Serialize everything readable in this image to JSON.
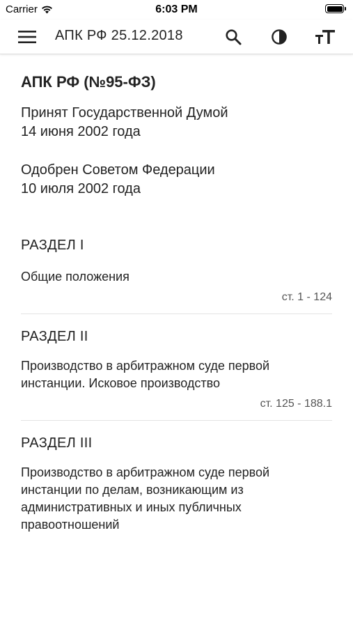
{
  "status_bar": {
    "carrier": "Carrier",
    "time": "6:03 PM",
    "battery_level": 1.0
  },
  "app_bar": {
    "title": "АПК РФ 25.12.2018",
    "actions": [
      "search-icon",
      "contrast-icon",
      "text-size-icon"
    ]
  },
  "document": {
    "title": "АПК РФ (№95-ФЗ)",
    "adopted_line1": "Принят Государственной Думой",
    "adopted_line2": "14 июня 2002 года",
    "approved_line1": "Одобрен Советом Федерации",
    "approved_line2": "10 июля 2002 года"
  },
  "sections": [
    {
      "heading": "РАЗДЕЛ I",
      "description": "Общие положения",
      "range": "ст. 1 - 124"
    },
    {
      "heading": "РАЗДЕЛ II",
      "description_line1": "Производство в арбитражном суде первой",
      "description_line2": "инстанции. Исковое производство",
      "range": "ст. 125 - 188.1"
    },
    {
      "heading": "РАЗДЕЛ III",
      "description_line1": "Производство в арбитражном суде первой",
      "description_line2": "инстанции по делам, возникающим из",
      "description_line3": "административных и иных публичных",
      "description_line4": "правоотношений"
    }
  ],
  "colors": {
    "text": "#222222",
    "muted": "#555555",
    "divider": "#e3e3e3"
  }
}
